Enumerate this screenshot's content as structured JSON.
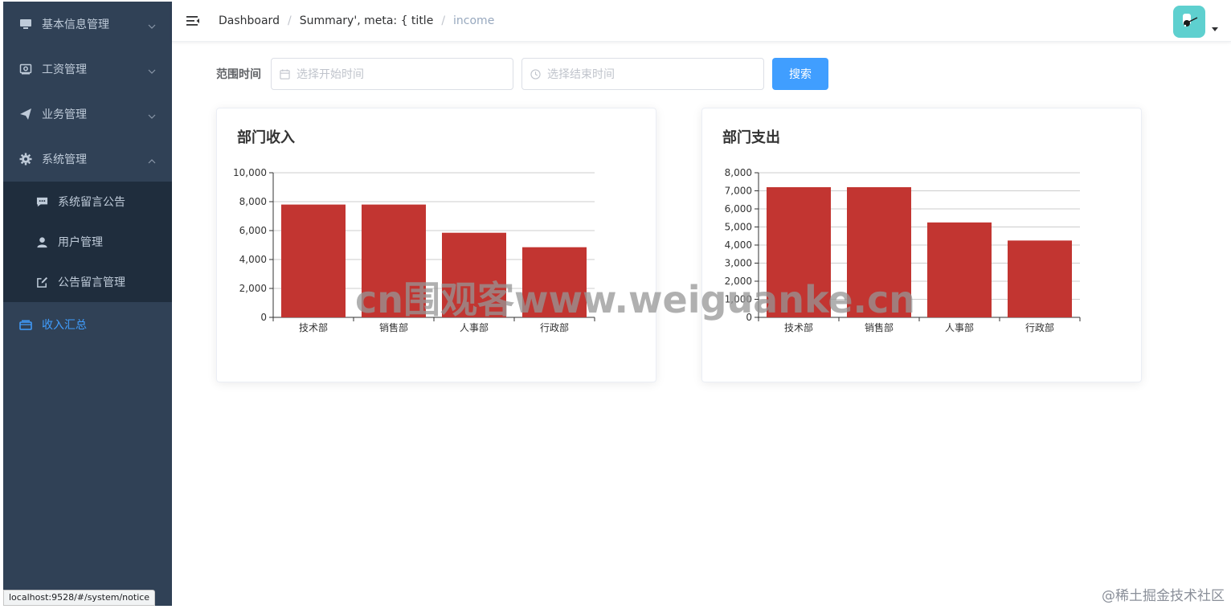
{
  "sidebar": {
    "items": [
      {
        "label": "基本信息管理",
        "icon": "monitor-icon"
      },
      {
        "label": "工资管理",
        "icon": "wallet-icon"
      },
      {
        "label": "业务管理",
        "icon": "paper-plane-icon"
      },
      {
        "label": "系统管理",
        "icon": "gear-icon"
      }
    ],
    "subitems": [
      {
        "label": "系统留言公告",
        "icon": "chat-icon"
      },
      {
        "label": "用户管理",
        "icon": "user-icon"
      },
      {
        "label": "公告留言管理",
        "icon": "edit-icon"
      }
    ],
    "active_item": {
      "label": "收入汇总",
      "icon": "folder-icon"
    }
  },
  "status_url": "localhost:9528/#/system/notice",
  "breadcrumb": [
    "Dashboard",
    "Summary', meta: { title",
    "income"
  ],
  "filter": {
    "label": "范围时间",
    "start_placeholder": "选择开始时间",
    "end_placeholder": "选择结束时间",
    "search_label": "搜索"
  },
  "colors": {
    "sidebar_bg": "#304156",
    "accent": "#409eff",
    "bar": "#c23531"
  },
  "chart_data": [
    {
      "type": "bar",
      "title": "部门收入",
      "categories": [
        "技术部",
        "销售部",
        "人事部",
        "行政部"
      ],
      "values": [
        7800,
        7800,
        5850,
        4850
      ],
      "ylim": [
        0,
        10000
      ],
      "yticks": [
        0,
        2000,
        4000,
        6000,
        8000,
        10000
      ],
      "ytick_labels": [
        "0",
        "2,000",
        "4,000",
        "6,000",
        "8,000",
        "10,000"
      ],
      "grid": true
    },
    {
      "type": "bar",
      "title": "部门支出",
      "categories": [
        "技术部",
        "销售部",
        "人事部",
        "行政部"
      ],
      "values": [
        7200,
        7200,
        5250,
        4250
      ],
      "ylim": [
        0,
        8000
      ],
      "yticks": [
        0,
        1000,
        2000,
        3000,
        4000,
        5000,
        6000,
        7000,
        8000
      ],
      "ytick_labels": [
        "0",
        "1,000",
        "2,000",
        "3,000",
        "4,000",
        "5,000",
        "6,000",
        "7,000",
        "8,000"
      ],
      "grid": true
    }
  ],
  "watermark": "cn围观客www.weiguanke.cn",
  "corner_mark": "@稀土掘金技术社区"
}
